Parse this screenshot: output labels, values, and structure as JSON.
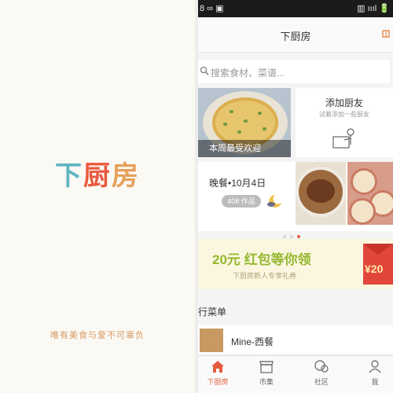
{
  "splash": {
    "logo_chars": [
      "下",
      "厨",
      "房"
    ],
    "logo_colors": [
      "#5fb6c1",
      "#e95a40",
      "#e69f59"
    ],
    "tagline": "唯有美食与爱不可辜负"
  },
  "status_bar": {
    "left": "8 ∞ ▣",
    "right": "▥ ıııl 🔋"
  },
  "header": {
    "title": "下厨房",
    "action_icon": "gift-icon"
  },
  "search": {
    "placeholder": "搜索食材、菜谱..."
  },
  "cards": {
    "weekly": {
      "caption": "本周最受欢迎"
    },
    "add_friend": {
      "title": "添加厨友",
      "subtitle": "试着添加一些厨友"
    }
  },
  "dinner": {
    "label": "晚餐•10月4日",
    "count": "408 作品"
  },
  "promo": {
    "headline": "20元 红包等你领",
    "subtitle": "下厨房新人专享礼券",
    "badge": "¥20"
  },
  "section": {
    "title": "行菜单"
  },
  "list": [
    {
      "label": "Mine-西餐"
    }
  ],
  "tabs": [
    {
      "label": "下厨房",
      "icon": "home-icon",
      "active": true
    },
    {
      "label": "市集",
      "icon": "market-icon",
      "active": false
    },
    {
      "label": "社区",
      "icon": "community-icon",
      "active": false
    },
    {
      "label": "我",
      "icon": "profile-icon",
      "active": false
    }
  ],
  "colors": {
    "accent": "#e35c3f",
    "promo_green": "#94b830"
  }
}
